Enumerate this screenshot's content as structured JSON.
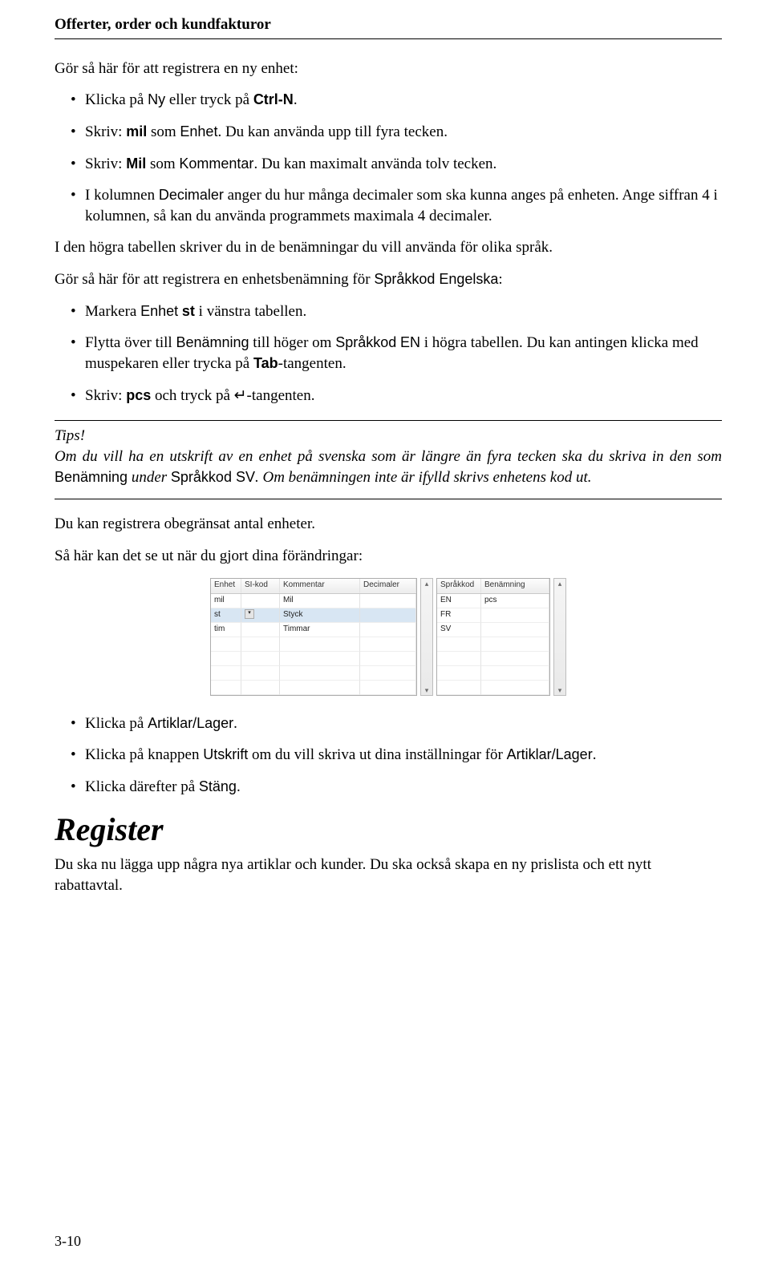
{
  "header": {
    "title": "Offerter, order och kundfakturor"
  },
  "intro": "Gör så här för att registrera en ny enhet:",
  "list1": {
    "i1": {
      "a": "Klicka på ",
      "ny": "Ny",
      "b": " eller tryck på ",
      "ctrln": "Ctrl-N",
      "c": "."
    },
    "i2": {
      "a": "Skriv: ",
      "mil": "mil",
      "b": " som ",
      "enhet": "Enhet",
      "c": ". Du kan använda upp till fyra tecken."
    },
    "i3": {
      "a": "Skriv: ",
      "milb": "Mil",
      "b": " som ",
      "komm": "Kommentar",
      "c": ". Du kan maximalt använda tolv tecken."
    },
    "i4": {
      "a": "I kolumnen ",
      "dec": "Decimaler",
      "b": " anger du hur många decimaler som ska kunna anges på enheten. Ange siffran 4 i kolumnen, så kan du använda programmets maximala 4 decimaler."
    }
  },
  "para2": "I den högra tabellen skriver du in de benämningar du vill använda för olika språk.",
  "para3": {
    "a": "Gör så här för att registrera en enhetsbenämning för ",
    "spr": "Språkkod Engelska",
    "b": ":"
  },
  "list2": {
    "i1": {
      "a": "Markera ",
      "enhet": "Enhet",
      "b": " ",
      "st": "st",
      "c": " i vänstra tabellen."
    },
    "i2": {
      "a": "Flytta över till ",
      "ben": "Benämning",
      "b": " till höger om ",
      "sprk": "Språkkod",
      "c": " ",
      "en": "EN",
      "d": " i högra tabellen. Du kan antingen klicka med muspekaren eller trycka på ",
      "tab": "Tab",
      "e": "-tangenten."
    },
    "i3": {
      "a": "Skriv: ",
      "pcs": "pcs",
      "b": " och tryck på ↵-tangenten."
    }
  },
  "tips": {
    "title": "Tips!",
    "body_a": "Om du vill ha en utskrift av en enhet på svenska som är längre än fyra tecken ska du skriva in den som ",
    "ben": "Benämning",
    "body_b": " under ",
    "sprk": "Språkkod SV",
    "body_c": ". Om benämningen inte är ifylld skrivs enhetens kod ut."
  },
  "para4": "Du kan registrera obegränsat antal enheter.",
  "para5": "Så här kan det se ut när du gjort dina förändringar:",
  "table_left": {
    "headers": [
      "Enhet",
      "SI-kod",
      "Kommentar",
      "Decimaler"
    ],
    "rows": [
      [
        "mil",
        "",
        "Mil",
        ""
      ],
      [
        "st",
        "▾",
        "Styck",
        ""
      ],
      [
        "tim",
        "",
        "Timmar",
        ""
      ],
      [
        "",
        "",
        "",
        ""
      ],
      [
        "",
        "",
        "",
        ""
      ],
      [
        "",
        "",
        "",
        ""
      ],
      [
        "",
        "",
        "",
        ""
      ]
    ]
  },
  "table_right": {
    "headers": [
      "Språkkod",
      "Benämning"
    ],
    "rows": [
      [
        "EN",
        "pcs"
      ],
      [
        "FR",
        ""
      ],
      [
        "SV",
        ""
      ],
      [
        "",
        ""
      ],
      [
        "",
        ""
      ],
      [
        "",
        ""
      ],
      [
        "",
        ""
      ]
    ]
  },
  "list3": {
    "i1": {
      "a": "Klicka på ",
      "al": "Artiklar/Lager",
      "b": "."
    },
    "i2": {
      "a": "Klicka på knappen ",
      "ut": "Utskrift",
      "b": " om du vill skriva ut dina inställningar för ",
      "al": "Artiklar/Lager",
      "c": "."
    },
    "i3": {
      "a": "Klicka därefter på ",
      "st": "Stäng",
      "b": "."
    }
  },
  "h1": "Register",
  "para6": "Du ska nu lägga upp några nya artiklar och kunder. Du ska också skapa en ny prislista och ett nytt rabattavtal.",
  "footer": {
    "pagenum": "3-10"
  }
}
